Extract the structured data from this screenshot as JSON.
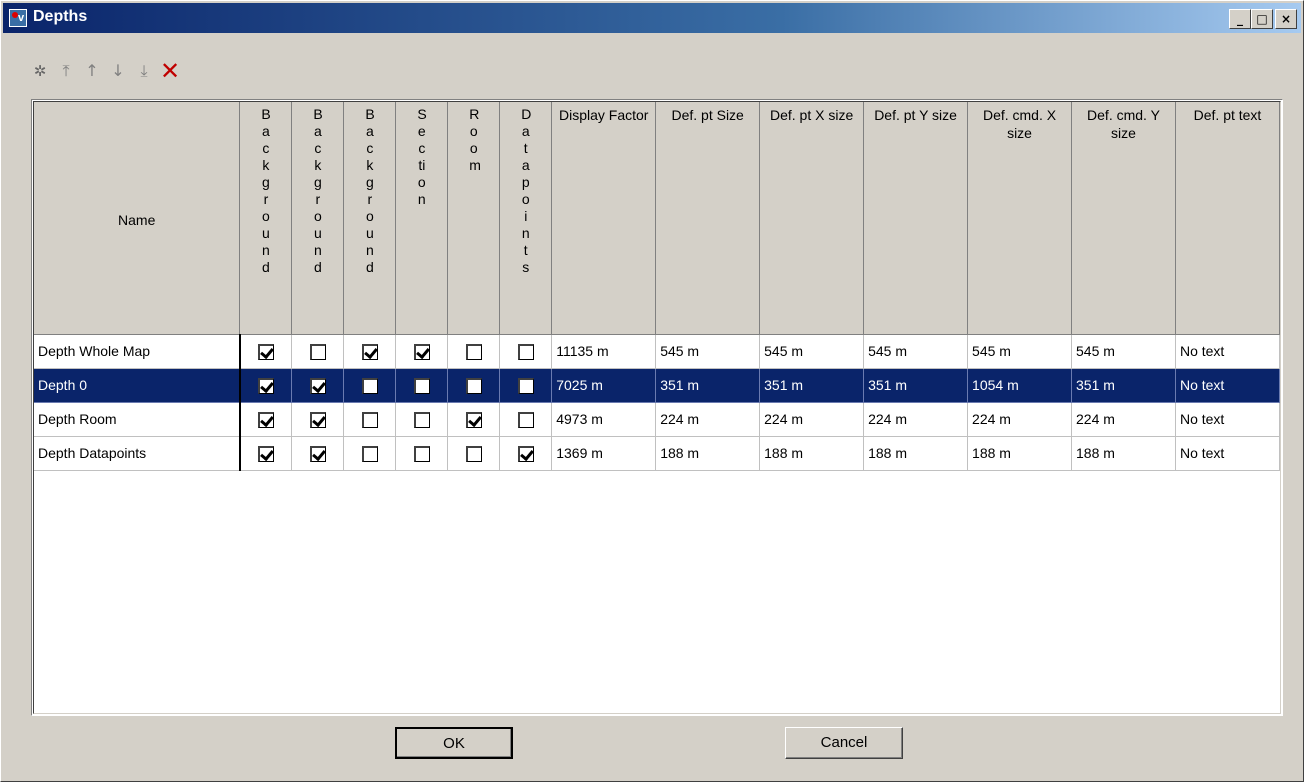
{
  "window": {
    "title": "Depths"
  },
  "winbtns": {
    "min": "_",
    "max": "□",
    "close": "×"
  },
  "toolbar": {
    "new_icon": "new-item-icon",
    "move_top_icon": "move-to-top-icon",
    "move_up_icon": "move-up-icon",
    "move_down_icon": "move-down-icon",
    "move_bottom_icon": "move-to-bottom-icon",
    "delete_icon": "delete-icon"
  },
  "table": {
    "headers": {
      "name": "Name",
      "bg1": "Background",
      "bg2": "Background",
      "bg3": "Background",
      "section": "Section",
      "room": "Room",
      "datapoints": "Datapoints",
      "display_factor": "Display Factor",
      "pt_size": "Def. pt Size",
      "pt_x": "Def. pt X size",
      "pt_y": "Def. pt Y size",
      "cmd_x": "Def. cmd. X size",
      "cmd_y": "Def. cmd. Y size",
      "pt_text": "Def. pt text"
    },
    "rows": [
      {
        "name": "Depth Whole Map",
        "checks": [
          true,
          false,
          true,
          true,
          false,
          false
        ],
        "display_factor": "11135 m",
        "pt_size": "545 m",
        "pt_x": "545 m",
        "pt_y": "545 m",
        "cmd_x": "545 m",
        "cmd_y": "545 m",
        "pt_text": "No text",
        "selected": false
      },
      {
        "name": "Depth 0",
        "checks": [
          true,
          true,
          false,
          false,
          false,
          false
        ],
        "display_factor": "7025 m",
        "pt_size": "351 m",
        "pt_x": "351 m",
        "pt_y": "351 m",
        "cmd_x": "1054 m",
        "cmd_y": "351 m",
        "pt_text": "No text",
        "selected": true
      },
      {
        "name": "Depth Room",
        "checks": [
          true,
          true,
          false,
          false,
          true,
          false
        ],
        "display_factor": "4973 m",
        "pt_size": "224 m",
        "pt_x": "224 m",
        "pt_y": "224 m",
        "cmd_x": "224 m",
        "cmd_y": "224 m",
        "pt_text": "No text",
        "selected": false
      },
      {
        "name": "Depth Datapoints",
        "checks": [
          true,
          true,
          false,
          false,
          false,
          true
        ],
        "display_factor": "1369 m",
        "pt_size": "188 m",
        "pt_x": "188 m",
        "pt_y": "188 m",
        "cmd_x": "188 m",
        "cmd_y": "188 m",
        "pt_text": "No text",
        "selected": false
      }
    ]
  },
  "buttons": {
    "ok": "OK",
    "cancel": "Cancel"
  }
}
